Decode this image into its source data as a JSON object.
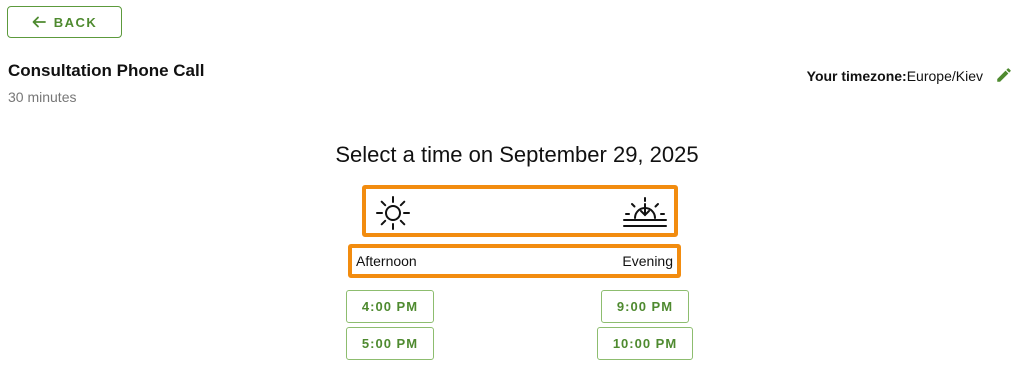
{
  "back_button": {
    "label": "BACK",
    "icon": "arrow-left-icon"
  },
  "event": {
    "title": "Consultation Phone Call",
    "duration": "30 minutes"
  },
  "timezone": {
    "label": "Your timezone:",
    "value": "Europe/Kiev",
    "edit_icon": "pencil-icon"
  },
  "heading": "Select a time on September 29, 2025",
  "period_icons": {
    "afternoon": "sun-icon",
    "evening": "sunset-icon"
  },
  "periods": {
    "afternoon": {
      "label": "Afternoon",
      "slots": [
        "4:00 PM",
        "5:00 PM"
      ]
    },
    "evening": {
      "label": "Evening",
      "slots": [
        "9:00 PM",
        "10:00 PM"
      ]
    }
  },
  "colors": {
    "accent_green": "#4e8a2f",
    "highlight_orange": "#f28c0f"
  }
}
